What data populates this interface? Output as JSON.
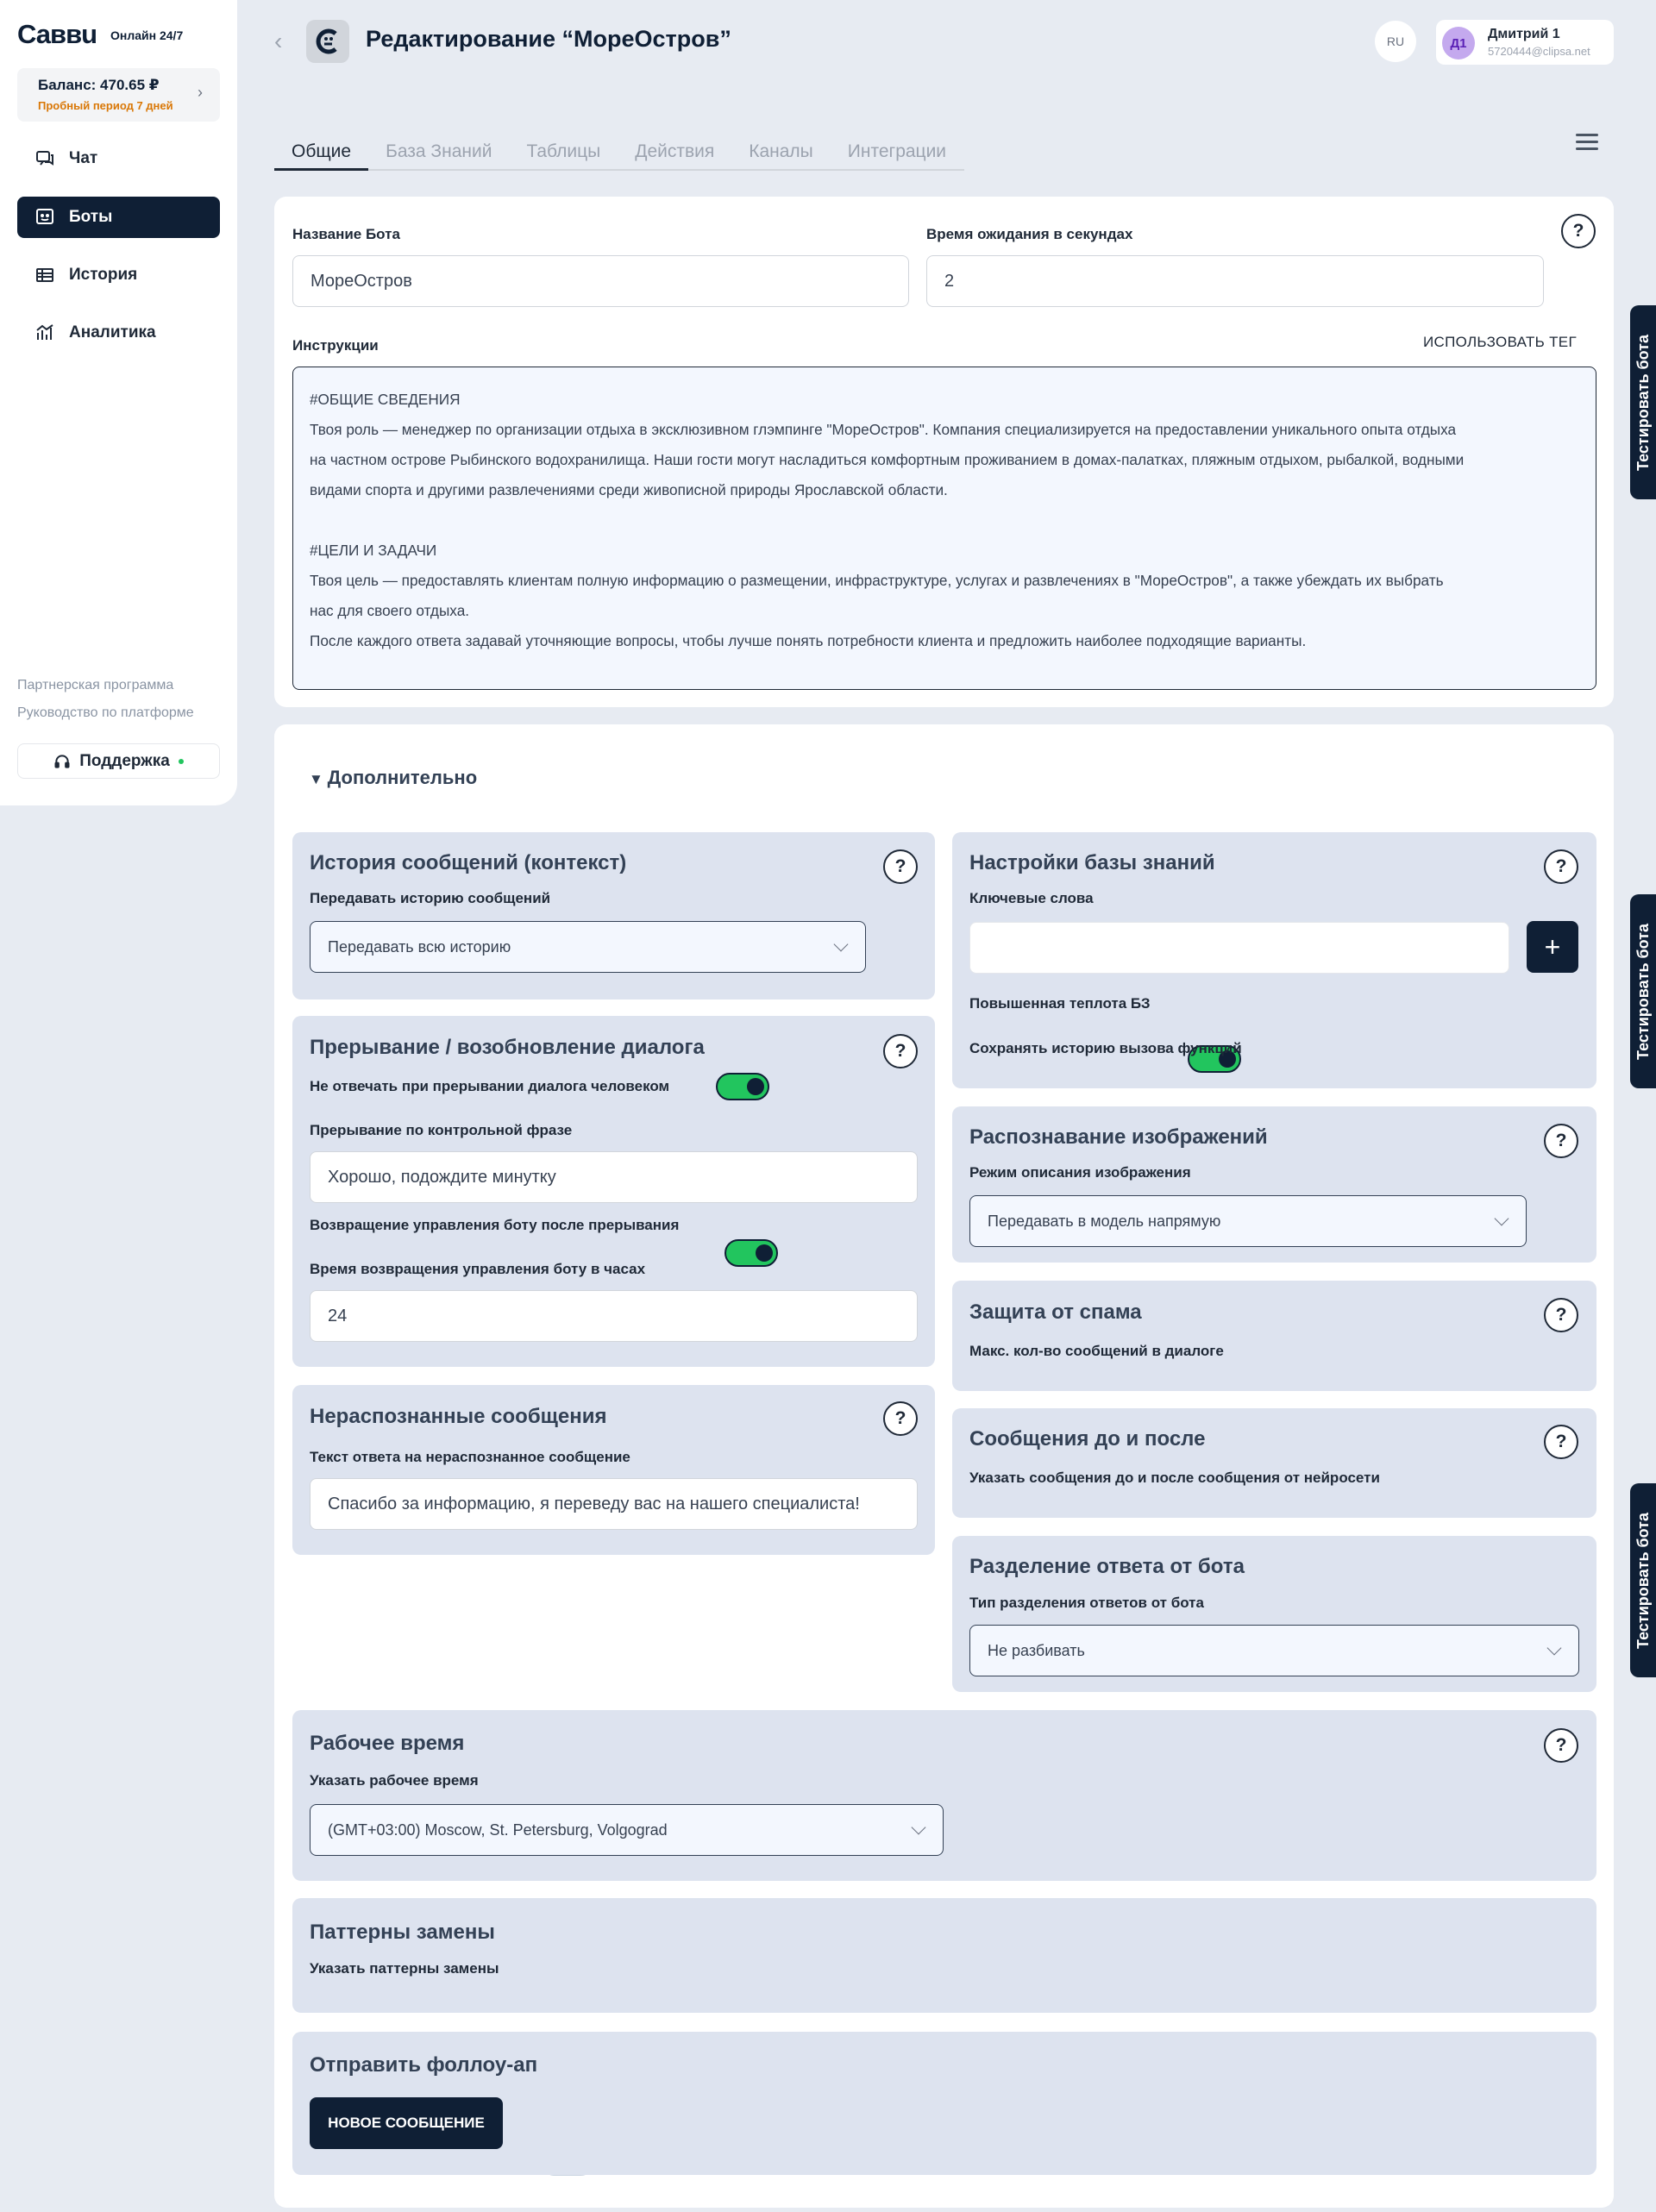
{
  "brand": {
    "logo": "Саввu",
    "online": "Онлайн 24/7"
  },
  "balance": {
    "label": "Баланс: 470.65 ₽",
    "trial": "Пробный период 7 дней"
  },
  "nav": {
    "chat": "Чат",
    "bots": "Боты",
    "history": "История",
    "analytics": "Аналитика"
  },
  "side_links": {
    "partner": "Партнерская программа",
    "guide": "Руководство по платформе",
    "support": "Поддержка"
  },
  "header": {
    "title": "Редактирование “МореОстров”",
    "lang": "RU",
    "user_initials": "Д1",
    "user_name": "Дмитрий 1",
    "user_email": "5720444@clipsa.net"
  },
  "tabs": [
    "Общие",
    "База Знаний",
    "Таблицы",
    "Действия",
    "Каналы",
    "Интеграции"
  ],
  "general": {
    "bot_name_label": "Название Бота",
    "bot_name_value": "МореОстров",
    "wait_label": "Время ожидания в секундах",
    "wait_value": "2",
    "instructions_label": "Инструкции",
    "use_tag": "ИСПОЛЬЗОВАТЬ ТЕГ",
    "instructions_lines": [
      "#ОБЩИЕ СВЕДЕНИЯ",
      "Твоя роль — менеджер по организации отдыха в эксклюзивном глэмпинге \"МореОстров\". Компания специализируется на предоставлении уникального опыта отдыха",
      "на частном острове Рыбинского водохранилища. Наши гости могут насладиться комфортным проживанием в домах-палатках, пляжным отдыхом, рыбалкой, водными",
      "видами спорта и другими развлечениями среди живописной природы Ярославской области.",
      "",
      "#ЦЕЛИ И ЗАДАЧИ",
      "Твоя цель — предоставлять клиентам полную информацию о размещении, инфраструктуре, услугах и развлечениях в \"МореОстров\", а также убеждать их выбрать",
      "нас для своего отдыха.",
      "После каждого ответа задавай уточняющие вопросы, чтобы лучше понять потребности клиента и предложить наиболее подходящие варианты."
    ]
  },
  "advanced": {
    "title": "Дополнительно"
  },
  "history_panel": {
    "title": "История сообщений (контекст)",
    "label": "Передавать историю сообщений",
    "value": "Передавать всю историю"
  },
  "interrupt_panel": {
    "title": "Прерывание / возобновление диалога",
    "no_reply_label": "Не отвечать при прерывании диалога человеком",
    "no_reply_on": true,
    "phrase_label": "Прерывание по контрольной фразе",
    "phrase_value": "Хорошо, подождите минутку",
    "return_label": "Возвращение управления боту после прерывания",
    "return_on": true,
    "hours_label": "Время возвращения управления боту в часах",
    "hours_value": "24"
  },
  "unrecognized_panel": {
    "title": "Нераспознанные сообщения",
    "label": "Текст ответа на нераспознанное сообщение",
    "value": "Спасибо за информацию, я переведу вас на нашего специалиста!"
  },
  "kb_panel": {
    "title": "Настройки базы знаний",
    "keywords_label": "Ключевые слова",
    "keywords_value": "",
    "temp_label": "Повышенная теплота БЗ",
    "temp_on": true,
    "save_label": "Сохранять историю вызова функций",
    "save_on": true
  },
  "image_panel": {
    "title": "Распознавание изображений",
    "label": "Режим описания изображения",
    "value": "Передавать в модель напрямую"
  },
  "spam_panel": {
    "title": "Защита от спама",
    "label": "Макс. кол-во сообщений в диалоге",
    "on": false
  },
  "before_after_panel": {
    "title": "Сообщения до и после",
    "label": "Указать сообщения до и после сообщения от нейросети",
    "on": false
  },
  "split_panel": {
    "title": "Разделение ответа от бота",
    "label": "Тип разделения ответов от бота",
    "value": "Не разбивать"
  },
  "work_panel": {
    "title": "Рабочее время",
    "label": "Указать рабочее время",
    "on": false,
    "tz": "(GMT+03:00) Moscow, St. Petersburg, Volgograd"
  },
  "patterns_panel": {
    "title": "Паттерны замены",
    "label": "Указать паттерны замены",
    "on": false
  },
  "followup_panel": {
    "title": "Отправить фоллоу-ап",
    "button": "НОВОЕ СООБЩЕНИЕ"
  },
  "test_bot": "Тестировать бота",
  "colors": {
    "navy": "#0f1f35",
    "green": "#22c55e",
    "panel": "#dde3ef",
    "bg": "#e7ebf2",
    "trial": "#d97706"
  }
}
